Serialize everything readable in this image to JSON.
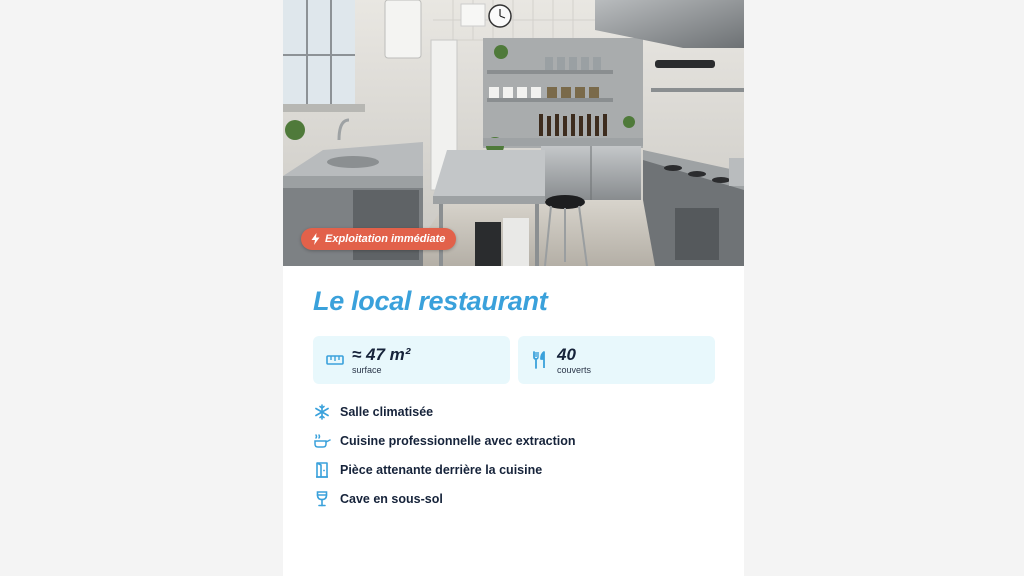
{
  "hero": {
    "image_alt": "Cuisine professionnelle en inox",
    "badge": {
      "icon": "lightning-icon",
      "label": "Exploitation immédiate",
      "color": "#e2614a"
    }
  },
  "title": "Le local restaurant",
  "stats": [
    {
      "icon": "ruler-icon",
      "value": "≈ 47 m²",
      "label": "surface"
    },
    {
      "icon": "cutlery-icon",
      "value": "40",
      "label": "couverts"
    }
  ],
  "features": [
    {
      "icon": "snowflake-icon",
      "label": "Salle climatisée"
    },
    {
      "icon": "cooking-pot-icon",
      "label": "Cuisine professionnelle avec extraction"
    },
    {
      "icon": "door-icon",
      "label": "Pièce attenante derrière la cuisine"
    },
    {
      "icon": "wine-glass-icon",
      "label": "Cave en sous-sol"
    }
  ],
  "colors": {
    "accent": "#3aa1db",
    "stat_bg": "#e8f8fc",
    "text": "#16233a"
  }
}
